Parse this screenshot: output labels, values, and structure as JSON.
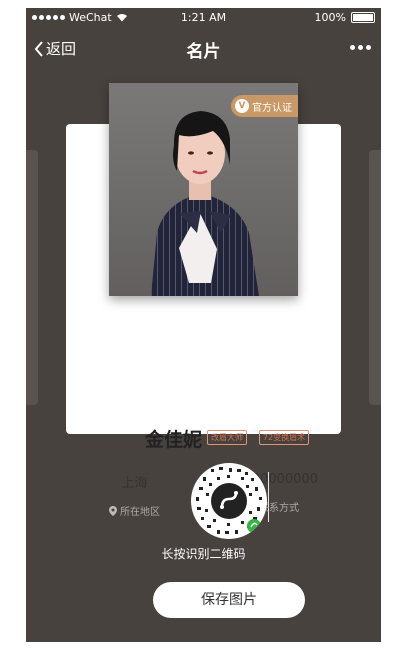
{
  "status_bar": {
    "signal": "●●●●● WeChat",
    "time": "1:21 AM",
    "battery": "100%"
  },
  "nav": {
    "back_label": "返回",
    "title": "名片"
  },
  "card": {
    "badge": "官方认证",
    "badge_icon_letter": "V",
    "name": "金佳妮",
    "tags": [
      "改眉大师",
      "72变换眉术"
    ],
    "location_value": "上海",
    "location_label": "所在地区",
    "phone_value": "18300000000",
    "phone_label": "联系方式"
  },
  "qr": {
    "label": "长按识别二维码"
  },
  "save_button": "保存图片",
  "colors": {
    "background": "#48423e",
    "badge": "#c89866",
    "tag": "#d07050"
  }
}
